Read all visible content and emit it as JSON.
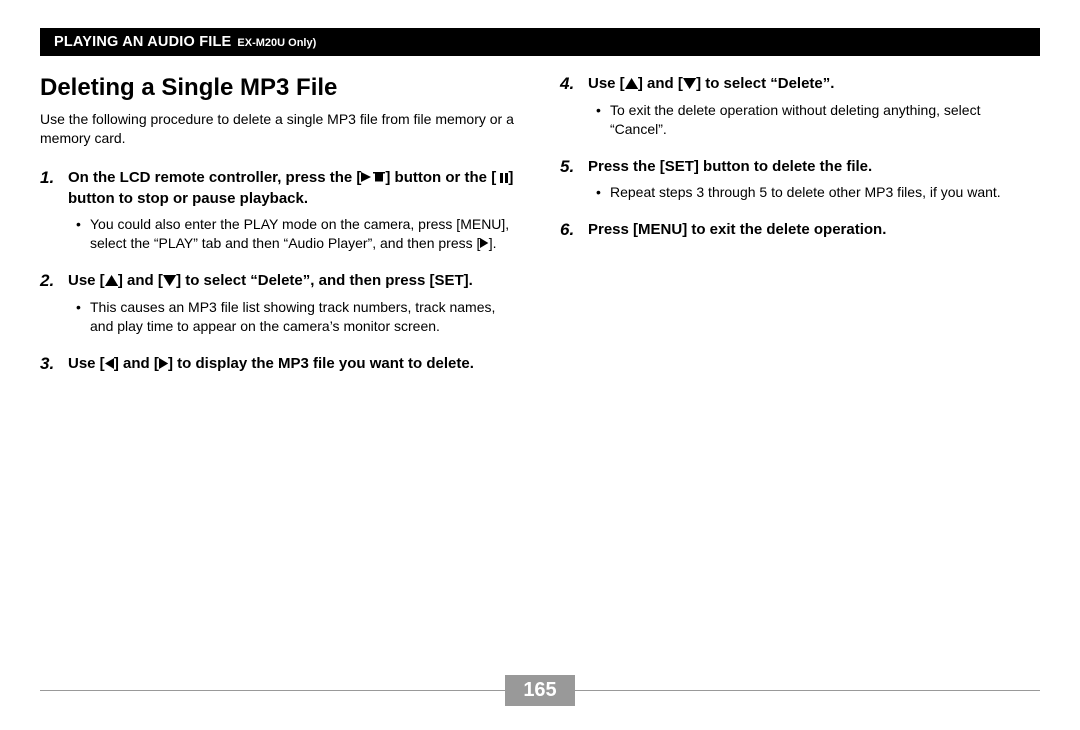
{
  "header": {
    "title": "PLAYING AN AUDIO FILE",
    "subtitle": "EX-M20U Only)"
  },
  "section": {
    "title": "Deleting a Single MP3 File",
    "intro": "Use the following procedure to delete a single MP3 file from file memory or a memory card."
  },
  "steps": {
    "s1": {
      "num": "1.",
      "t_a": "On the LCD remote controller, press the [",
      "t_b": "] button or the [",
      "t_c": "] button to stop or pause playback.",
      "sub_a": "You could also enter the PLAY mode on the camera, press [MENU], select the “PLAY” tab and then “Audio Player”, and then press [",
      "sub_b": "]."
    },
    "s2": {
      "num": "2.",
      "t_a": "Use [",
      "t_b": "] and [",
      "t_c": "] to select “Delete”, and then press [SET].",
      "sub": "This causes an MP3 file list showing track numbers, track names, and play time to appear on the camera’s monitor screen."
    },
    "s3": {
      "num": "3.",
      "t_a": "Use [",
      "t_b": "] and [",
      "t_c": "] to display the MP3 file you want to delete."
    },
    "s4": {
      "num": "4.",
      "t_a": "Use [",
      "t_b": "] and [",
      "t_c": "] to select  “Delete”.",
      "sub": "To exit the delete operation without deleting anything, select “Cancel”."
    },
    "s5": {
      "num": "5.",
      "text": "Press the [SET] button to delete the file.",
      "sub": "Repeat steps 3 through 5 to delete other MP3 files, if you want."
    },
    "s6": {
      "num": "6.",
      "text": "Press [MENU] to exit the delete operation."
    }
  },
  "page_number": "165",
  "bullet_char": "•"
}
